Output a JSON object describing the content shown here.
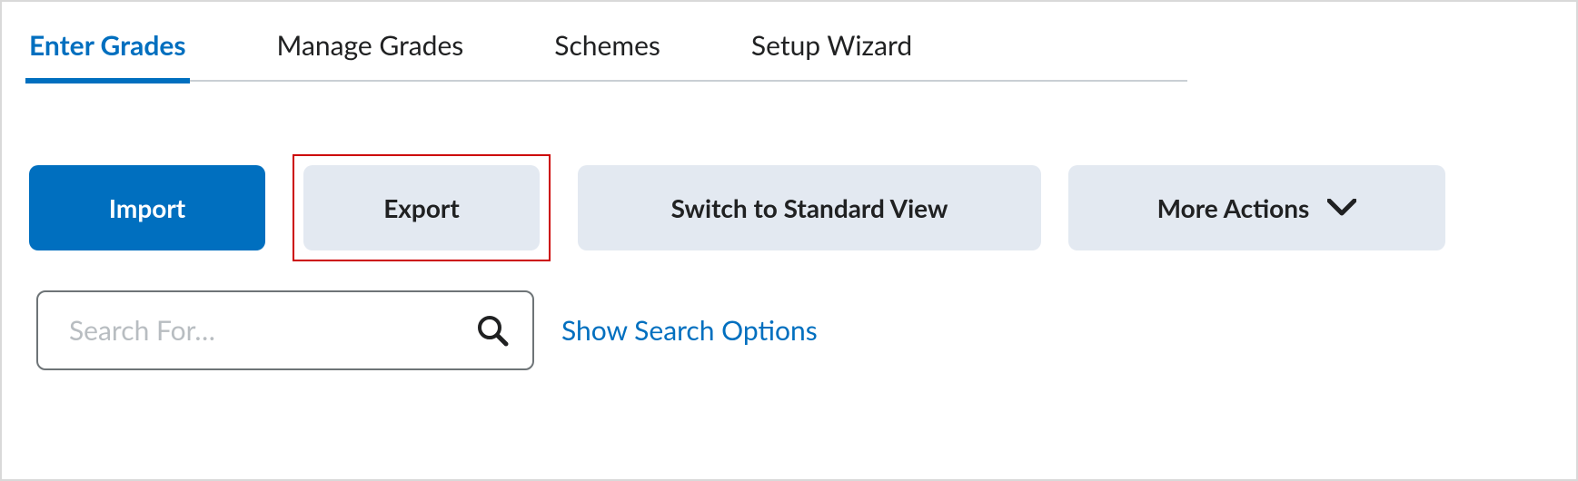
{
  "tabs": [
    {
      "label": "Enter Grades",
      "active": true
    },
    {
      "label": "Manage Grades",
      "active": false
    },
    {
      "label": "Schemes",
      "active": false
    },
    {
      "label": "Setup Wizard",
      "active": false
    }
  ],
  "toolbar": {
    "import_label": "Import",
    "export_label": "Export",
    "switch_view_label": "Switch to Standard View",
    "more_actions_label": "More Actions"
  },
  "search": {
    "placeholder": "Search For…",
    "value": "",
    "options_link": "Show Search Options"
  }
}
